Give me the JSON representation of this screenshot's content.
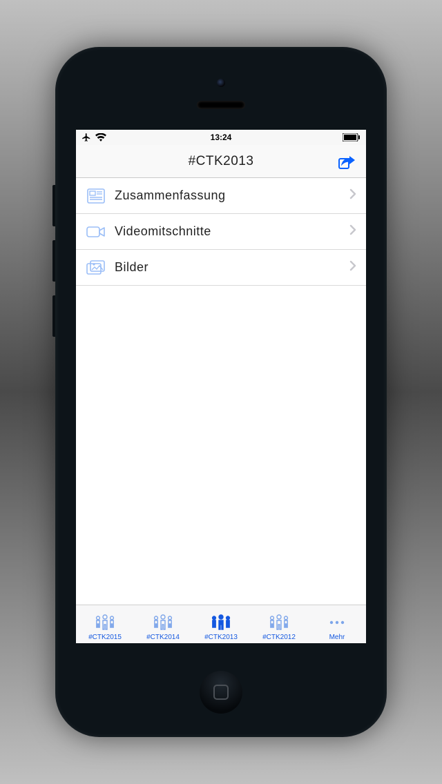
{
  "status": {
    "time": "13:24"
  },
  "header": {
    "title": "#CTK2013"
  },
  "rows": [
    {
      "icon": "newspaper-icon",
      "label": "Zusammenfassung"
    },
    {
      "icon": "video-icon",
      "label": "Videomitschnitte"
    },
    {
      "icon": "images-icon",
      "label": "Bilder"
    }
  ],
  "tabs": [
    {
      "label": "#CTK2015",
      "active": false
    },
    {
      "label": "#CTK2014",
      "active": false
    },
    {
      "label": "#CTK2013",
      "active": true
    },
    {
      "label": "#CTK2012",
      "active": false
    },
    {
      "label": "Mehr",
      "active": false,
      "more": true
    }
  ]
}
